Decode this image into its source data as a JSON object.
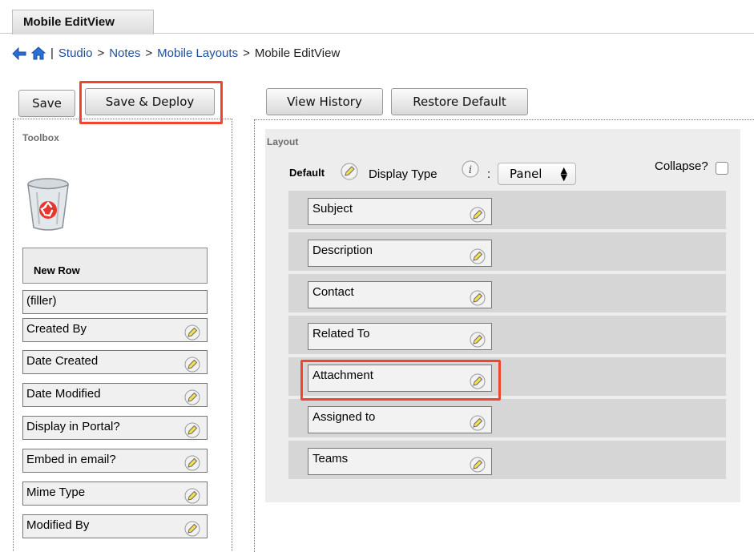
{
  "tab": {
    "title": "Mobile EditView"
  },
  "breadcrumb": {
    "separator": "|",
    "studio": "Studio",
    "notes": "Notes",
    "mobile_layouts": "Mobile Layouts",
    "current": "Mobile EditView",
    "arrow": ">"
  },
  "toolbar": {
    "save_label": "Save",
    "save_deploy_label": "Save & Deploy",
    "view_history_label": "View History",
    "restore_default_label": "Restore Default"
  },
  "toolbox": {
    "title": "Toolbox",
    "new_row_label": "New Row",
    "filler_label": "(filler)",
    "fields": [
      "Created By",
      "Date Created",
      "Date Modified",
      "Display in Portal?",
      "Embed in email?",
      "Mime Type",
      "Modified By"
    ]
  },
  "layout": {
    "title": "Layout",
    "panel_name": "Default",
    "display_type_label": "Display Type",
    "colon": ":",
    "display_type_value": "Panel",
    "collapse_label": "Collapse?",
    "collapse_checked": false,
    "fields": [
      "Subject",
      "Description",
      "Contact",
      "Related To",
      "Attachment",
      "Assigned to",
      "Teams"
    ]
  },
  "colors": {
    "highlight": "#f0442e",
    "link": "#1d4f9c",
    "panel_bg": "#ededed",
    "row_bg": "#d6d6d6"
  }
}
